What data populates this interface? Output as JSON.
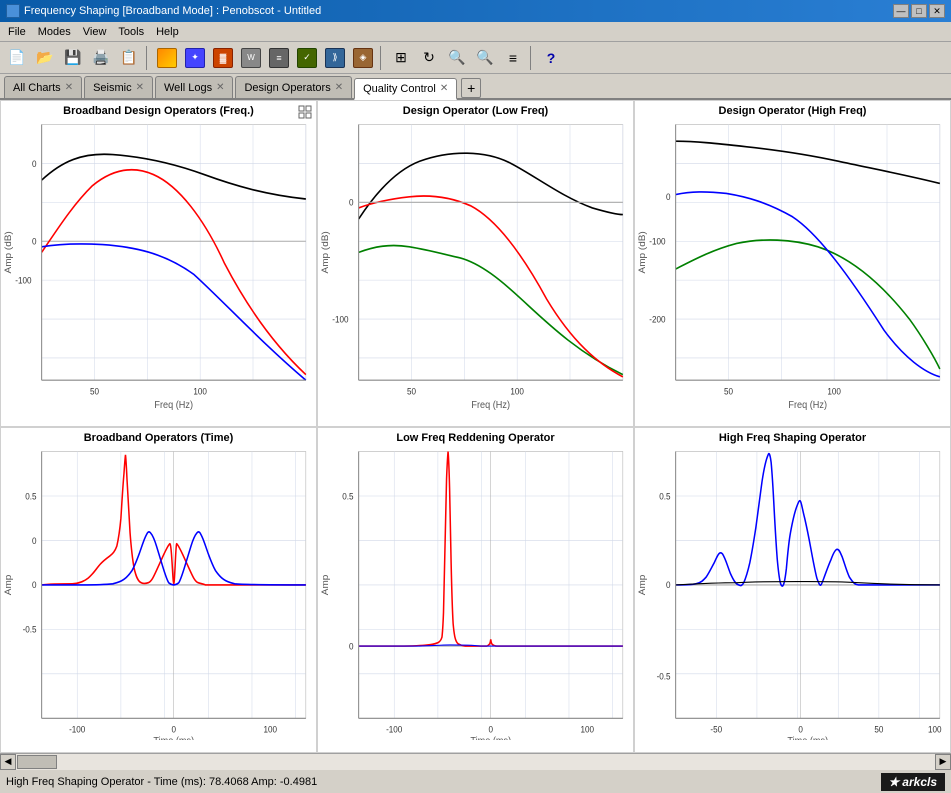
{
  "titlebar": {
    "title": "Frequency Shaping [Broadband Mode] : Penobscot - Untitled",
    "icon": "🔵",
    "min_btn": "—",
    "max_btn": "□",
    "close_btn": "✕"
  },
  "menubar": {
    "items": [
      "File",
      "Modes",
      "View",
      "Tools",
      "Help"
    ]
  },
  "tabs": [
    {
      "label": "All Charts",
      "active": false,
      "id": "all-charts"
    },
    {
      "label": "Seismic",
      "active": false,
      "id": "seismic"
    },
    {
      "label": "Well Logs",
      "active": false,
      "id": "well-logs"
    },
    {
      "label": "Design Operators",
      "active": false,
      "id": "design-operators"
    },
    {
      "label": "Quality Control",
      "active": true,
      "id": "quality-control"
    }
  ],
  "charts": [
    {
      "id": "broadband-freq",
      "title": "Broadband Design Operators (Freq.)",
      "position": "top-left",
      "x_label": "Freq (Hz)",
      "y_label": "Amp (dB)"
    },
    {
      "id": "design-op-low",
      "title": "Design Operator (Low Freq)",
      "position": "top-center",
      "x_label": "Freq (Hz)",
      "y_label": "Amp (dB)"
    },
    {
      "id": "design-op-high",
      "title": "Design Operator (High Freq)",
      "position": "top-right",
      "x_label": "Freq (Hz)",
      "y_label": "Amp (dB)"
    },
    {
      "id": "broadband-time",
      "title": "Broadband Operators (Time)",
      "position": "bottom-left",
      "x_label": "Time (ms)",
      "y_label": "Amp"
    },
    {
      "id": "low-freq-reddening",
      "title": "Low Freq Reddening Operator",
      "position": "bottom-center",
      "x_label": "Time (ms)",
      "y_label": "Amp"
    },
    {
      "id": "high-freq-shaping",
      "title": "High Freq Shaping Operator",
      "position": "bottom-right",
      "x_label": "Time (ms)",
      "y_label": "Amp"
    }
  ],
  "statusbar": {
    "text": "High Freq Shaping Operator  -  Time (ms): 78.4068  Amp: -0.4981",
    "logo": "★arkcls"
  }
}
